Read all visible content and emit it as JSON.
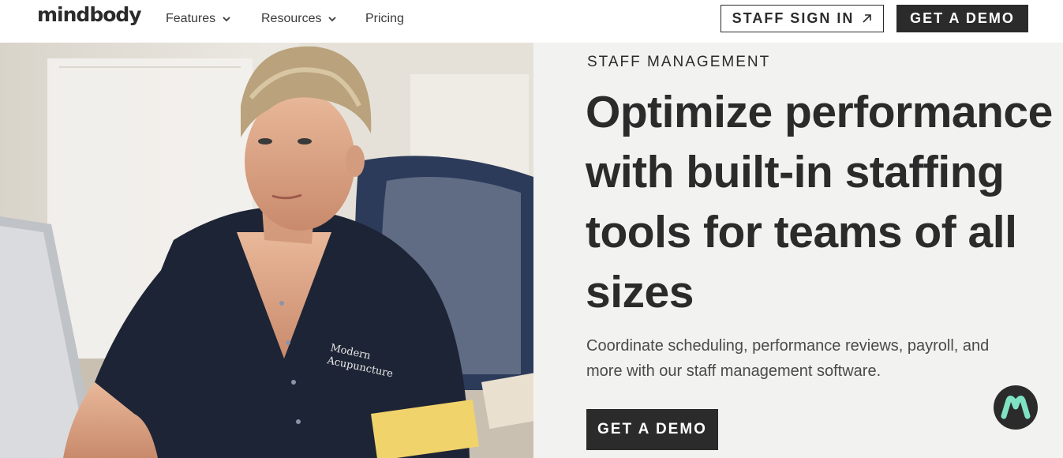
{
  "brand": {
    "logo_text": "mindbody"
  },
  "nav": {
    "items": [
      {
        "label": "Features",
        "has_dropdown": true
      },
      {
        "label": "Resources",
        "has_dropdown": true
      },
      {
        "label": "Pricing",
        "has_dropdown": false
      }
    ],
    "staff_sign_in": "STAFF SIGN IN",
    "get_demo": "GET A DEMO"
  },
  "hero": {
    "eyebrow": "STAFF MANAGEMENT",
    "headline": "Optimize performance with built-in staffing tools for teams of all sizes",
    "subtext": "Coordinate scheduling, performance reviews, payroll, and more with our staff management software.",
    "cta": "GET A DEMO",
    "image": {
      "shirt_text_line1": "Modern",
      "shirt_text_line2": "Acupuncture"
    }
  },
  "chat": {
    "icon": "m-logo-icon",
    "accent": "#7fe3c3"
  },
  "colors": {
    "dark": "#2b2b2b",
    "panel_bg": "#f2f2f0",
    "white": "#ffffff"
  }
}
